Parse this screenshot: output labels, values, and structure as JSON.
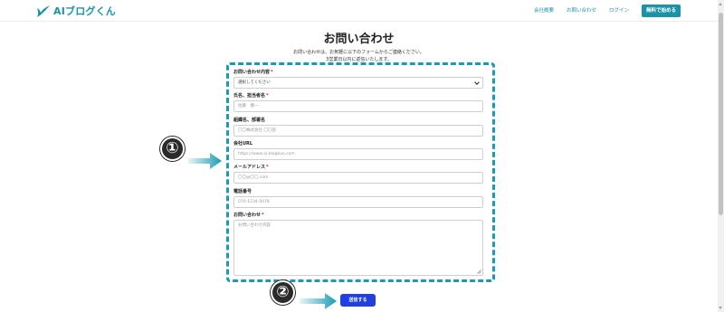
{
  "header": {
    "logo_text": "AIブログくん",
    "nav": [
      "会社概要",
      "お問い合わせ",
      "ログイン"
    ],
    "cta_label": "無料で始める",
    "brand_color": "#1b93a6"
  },
  "page": {
    "title": "お問い合わせ",
    "intro_line1": "お問い合わせは、お気軽に以下のフォームからご連絡ください。",
    "intro_line2": "3営業日以内に返信いたします。"
  },
  "form": {
    "required_mark": "*",
    "inquiry_type": {
      "label": "お問い合わせ内容",
      "value": "選択してください"
    },
    "name": {
      "label": "氏名、担当者名",
      "placeholder": "佐藤　健一"
    },
    "organization": {
      "label": "組織名、部署名",
      "placeholder": "〇〇株式会社 〇〇部"
    },
    "company_url": {
      "label": "会社URL",
      "placeholder": "https://www.ai-blogkun.com"
    },
    "email": {
      "label": "メールアドレス",
      "placeholder": "〇〇@〇〇.com"
    },
    "phone": {
      "label": "電話番号",
      "placeholder": "070-1234-5678"
    },
    "message": {
      "label": "お問い合わせ",
      "placeholder": "お問い合わせ内容"
    },
    "submit_label": "送信する",
    "submit_color": "#1f3fe0"
  },
  "annotations": {
    "marker_1": "①",
    "marker_2": "②",
    "highlight_color": "#1b9bb3"
  }
}
